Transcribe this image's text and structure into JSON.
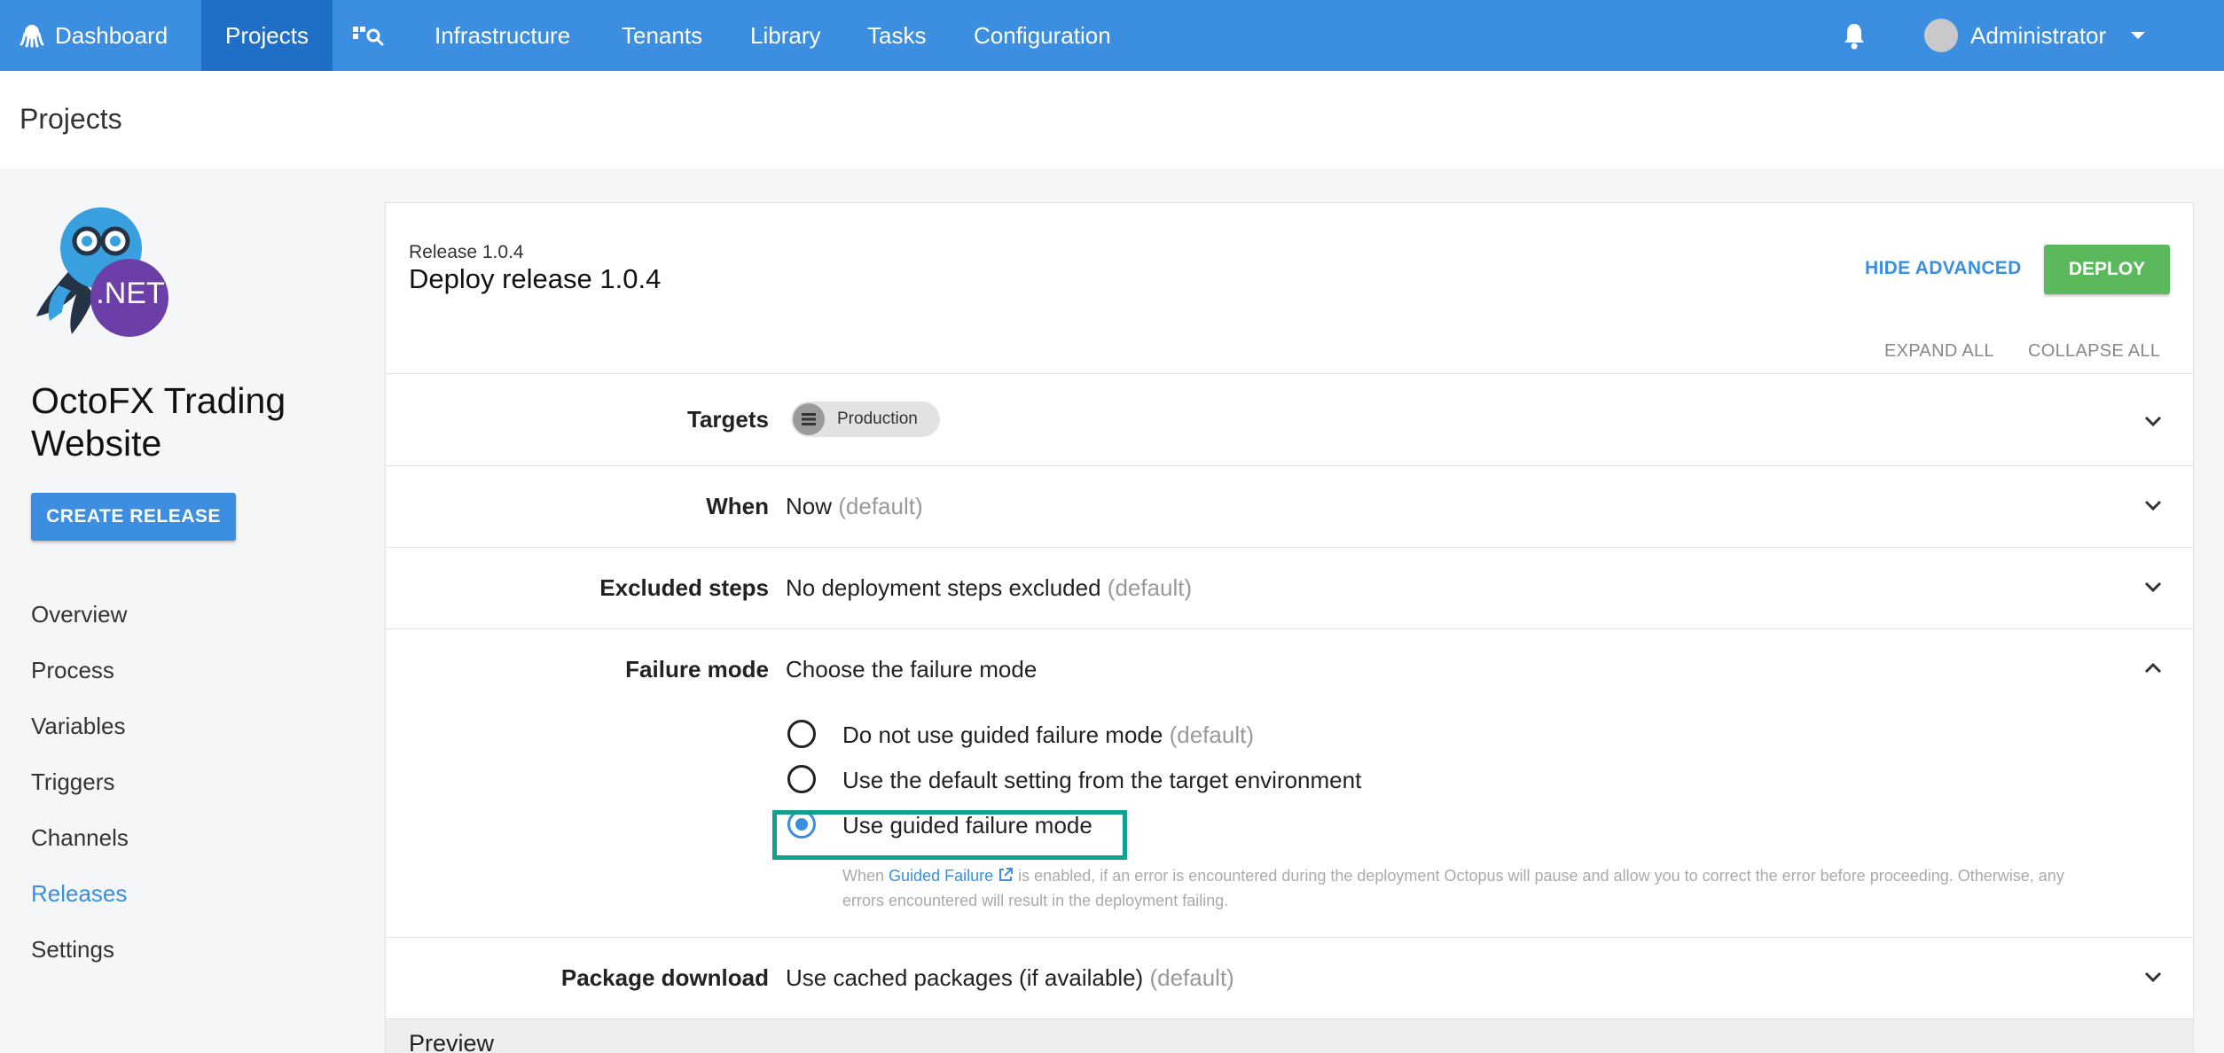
{
  "nav": {
    "items": [
      {
        "label": "Dashboard"
      },
      {
        "label": "Projects"
      },
      {
        "label": ""
      },
      {
        "label": "Infrastructure"
      },
      {
        "label": "Tenants"
      },
      {
        "label": "Library"
      },
      {
        "label": "Tasks"
      },
      {
        "label": "Configuration"
      }
    ],
    "user": "Administrator",
    "accent": "#3b8ee0",
    "active_bg": "#1f6fc6"
  },
  "page": {
    "title": "Projects"
  },
  "project": {
    "logo_text": ".NET",
    "name": "OctoFX Trading Website",
    "create_release": "CREATE RELEASE",
    "links": [
      {
        "label": "Overview"
      },
      {
        "label": "Process"
      },
      {
        "label": "Variables"
      },
      {
        "label": "Triggers"
      },
      {
        "label": "Channels"
      },
      {
        "label": "Releases"
      },
      {
        "label": "Settings"
      }
    ]
  },
  "deploy": {
    "release_label": "Release 1.0.4",
    "title": "Deploy release 1.0.4",
    "hide_advanced": "HIDE ADVANCED",
    "deploy_button": "DEPLOY",
    "expand_all": "EXPAND ALL",
    "collapse_all": "COLLAPSE ALL",
    "targets": {
      "label": "Targets",
      "chip": "Production"
    },
    "when": {
      "label": "When",
      "value": "Now",
      "default": "(default)"
    },
    "excluded_steps": {
      "label": "Excluded steps",
      "value": "No deployment steps excluded",
      "default": "(default)"
    },
    "failure_mode": {
      "label": "Failure mode",
      "value": "Choose the failure mode",
      "options": [
        {
          "label": "Do not use guided failure mode",
          "suffix": "(default)",
          "selected": false
        },
        {
          "label": "Use the default setting from the target environment",
          "suffix": "",
          "selected": false
        },
        {
          "label": "Use guided failure mode",
          "suffix": "",
          "selected": true
        }
      ],
      "help_prefix": "When",
      "help_link": "Guided Failure",
      "help_suffix": "is enabled, if an error is encountered during the deployment Octopus will pause and allow you to correct the error before proceeding. Otherwise, any errors encountered will result in the deployment failing."
    },
    "package_download": {
      "label": "Package download",
      "value": "Use cached packages (if available)",
      "default": "(default)"
    },
    "preview": "Preview"
  },
  "colors": {
    "deploy_green": "#5cb85c",
    "highlight": "#12a08e"
  }
}
